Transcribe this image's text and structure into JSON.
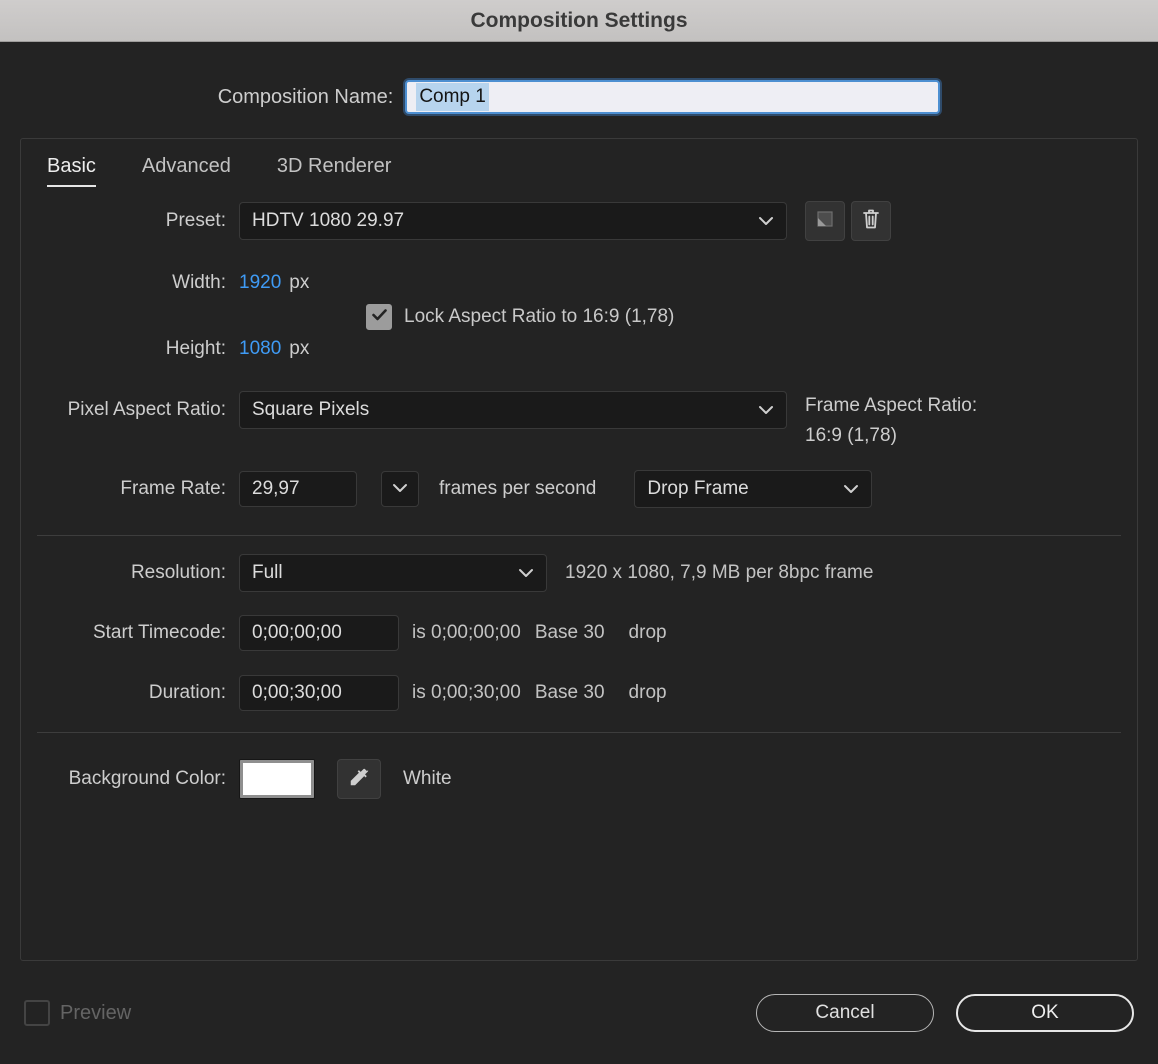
{
  "title": "Composition Settings",
  "composition_name": {
    "label": "Composition Name:",
    "value": "Comp 1"
  },
  "tabs": {
    "basic": "Basic",
    "advanced": "Advanced",
    "renderer": "3D Renderer"
  },
  "preset": {
    "label": "Preset:",
    "value": "HDTV 1080 29.97"
  },
  "dimensions": {
    "width_label": "Width:",
    "width_value": "1920",
    "width_unit": "px",
    "height_label": "Height:",
    "height_value": "1080",
    "height_unit": "px",
    "lock_label": "Lock Aspect Ratio to 16:9 (1,78)",
    "lock_checked": true
  },
  "pixel_aspect": {
    "label": "Pixel Aspect Ratio:",
    "value": "Square Pixels"
  },
  "frame_aspect": {
    "label": "Frame Aspect Ratio:",
    "value": "16:9 (1,78)"
  },
  "frame_rate": {
    "label": "Frame Rate:",
    "value": "29,97",
    "suffix": "frames per second",
    "drop_value": "Drop Frame"
  },
  "resolution": {
    "label": "Resolution:",
    "value": "Full",
    "info": "1920 x 1080, 7,9 MB per 8bpc frame"
  },
  "start_timecode": {
    "label": "Start Timecode:",
    "value": "0;00;00;00",
    "is_text": "is 0;00;00;00",
    "base_text": "Base 30",
    "drop_text": "drop"
  },
  "duration": {
    "label": "Duration:",
    "value": "0;00;30;00",
    "is_text": "is 0;00;30;00",
    "base_text": "Base 30",
    "drop_text": "drop"
  },
  "background_color": {
    "label": "Background Color:",
    "swatch": "#ffffff",
    "value": "White"
  },
  "footer": {
    "preview": "Preview",
    "preview_checked": false,
    "cancel": "Cancel",
    "ok": "OK"
  },
  "colors": {
    "value_blue": "#3f9bf5",
    "dialog_bg": "#232323",
    "titlebar_bg": "#c9c7c6",
    "focus_blue": "#4d8fd1"
  }
}
